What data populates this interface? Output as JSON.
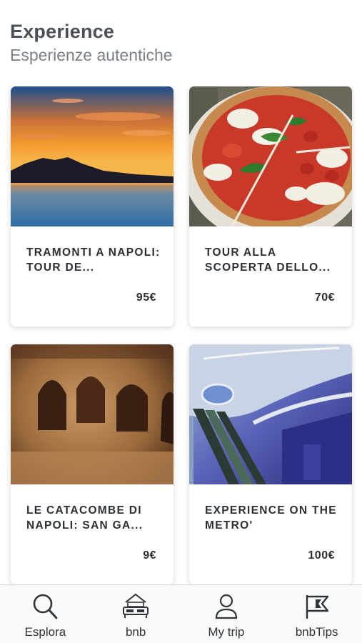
{
  "header": {
    "title": "Experience",
    "subtitle": "Esperienze autentiche"
  },
  "cards": [
    {
      "title": "TRAMONTI A NAPOLI: TOUR DE...",
      "price": "95€",
      "image": "sunset-vesuvius-image"
    },
    {
      "title": "TOUR ALLA SCOPERTA DELLO...",
      "price": "70€",
      "image": "pizza-image"
    },
    {
      "title": "LE CATACOMBE DI NAPOLI: SAN GA...",
      "price": "9€",
      "image": "catacombs-image"
    },
    {
      "title": "EXPERIENCE ON THE METRO'",
      "price": "100€",
      "image": "metro-station-image"
    }
  ],
  "tabbar": {
    "items": [
      {
        "label": "Esplora",
        "icon": "search-icon"
      },
      {
        "label": "bnb",
        "icon": "bed-icon"
      },
      {
        "label": "My trip",
        "icon": "user-icon"
      },
      {
        "label": "bnbTips",
        "icon": "flag-icon"
      }
    ]
  },
  "colors": {
    "text_dark": "#2b2f33",
    "title_gray": "#4a5056",
    "subtitle_gray": "#7b8087",
    "tabbar_bg": "#fafafa"
  }
}
